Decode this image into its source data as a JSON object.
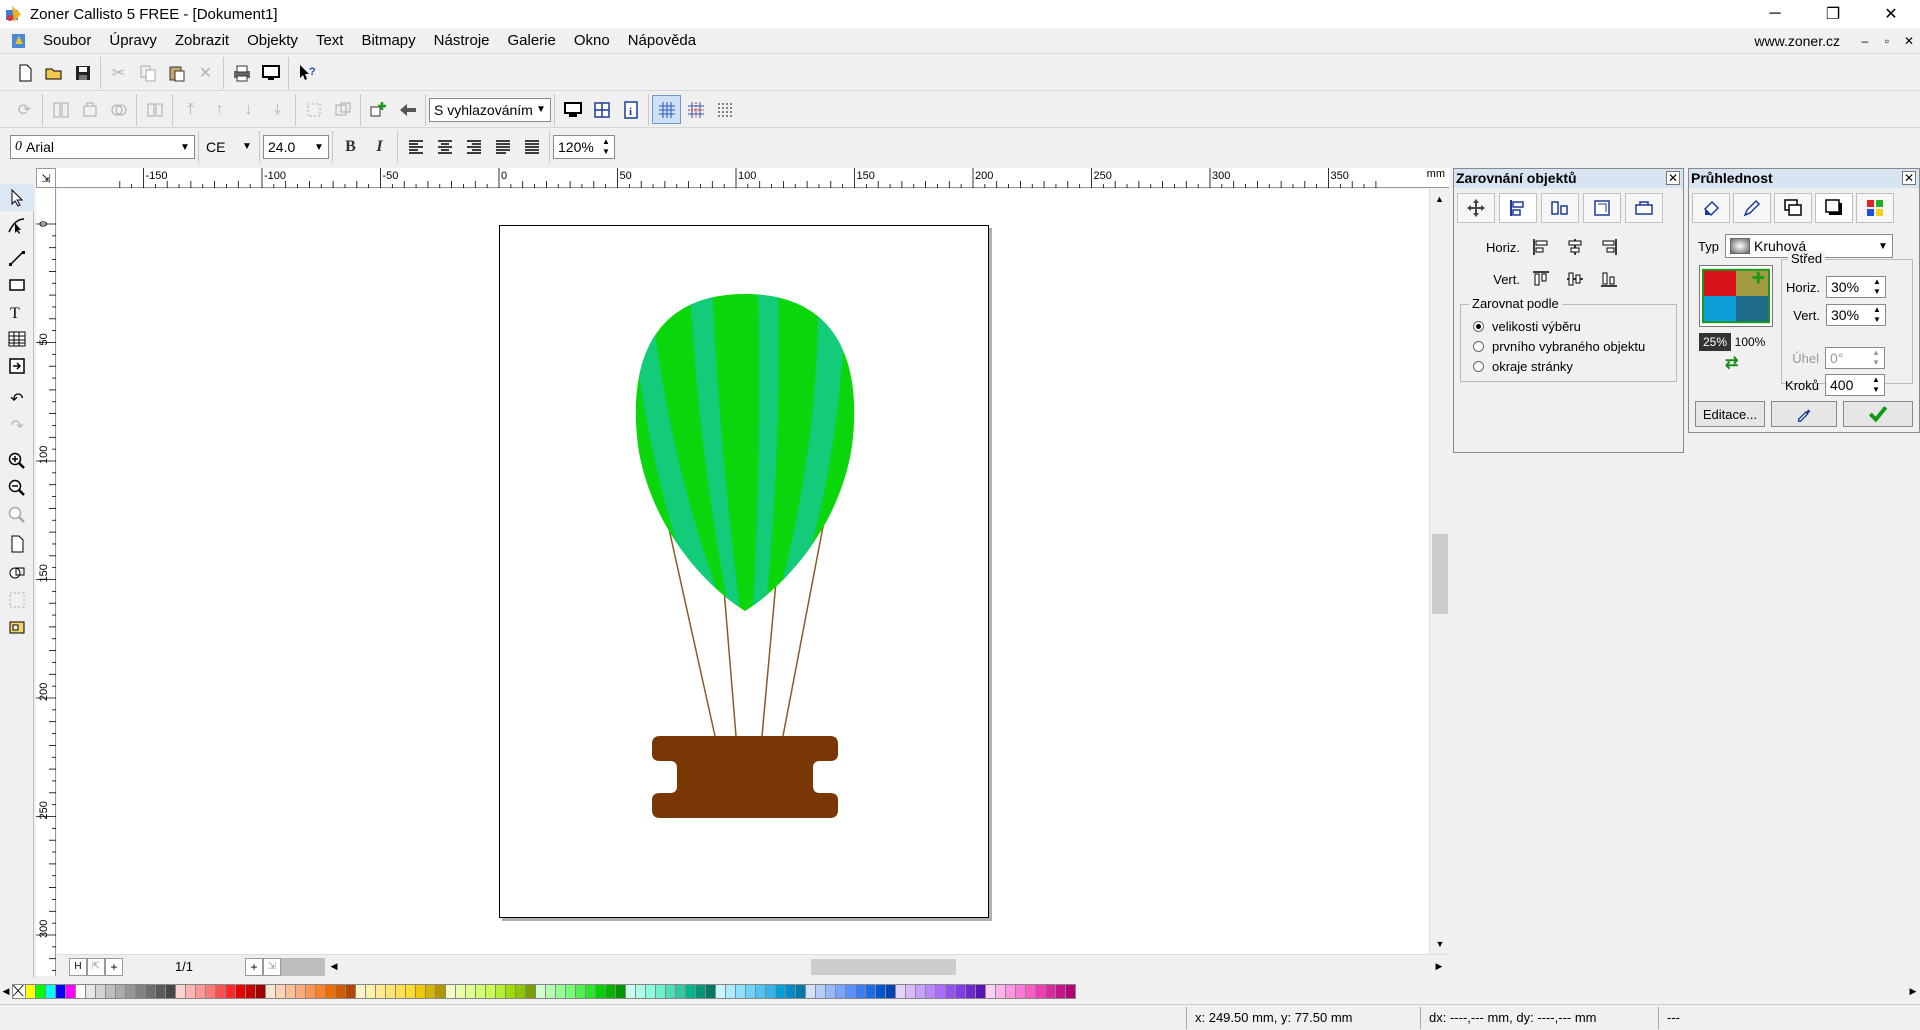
{
  "window": {
    "title": "Zoner Callisto 5 FREE - [Dokument1]",
    "controls": {
      "minimize": "─",
      "maximize": "❐",
      "close": "✕"
    }
  },
  "menu": {
    "items": [
      "Soubor",
      "Úpravy",
      "Zobrazit",
      "Objekty",
      "Text",
      "Bitmapy",
      "Nástroje",
      "Galerie",
      "Okno",
      "Nápověda"
    ],
    "site": "www.zoner.cz",
    "mdi": {
      "minimize": "–",
      "restore": "▫",
      "close": "✕"
    }
  },
  "toolbar2": {
    "smoothing": "S vyhlazováním"
  },
  "toolbar3": {
    "font": "Arial",
    "charset": "CE",
    "size": "24.0",
    "bold": "B",
    "italic": "I",
    "spacing": "120%"
  },
  "rulers": {
    "unit": "mm",
    "h_ticks": [
      "-150",
      "-100",
      "-50",
      "0",
      "50",
      "100",
      "150",
      "200",
      "250",
      "300",
      "350"
    ],
    "v_ticks": [
      "0",
      "50",
      "100",
      "150",
      "200",
      "250",
      "300"
    ]
  },
  "pager": {
    "first": "H",
    "prev": "⇱",
    "add": "+",
    "page": "1/1",
    "add2": "+",
    "last": "⇲"
  },
  "align_panel": {
    "title": "Zarovnání objektů",
    "horiz_label": "Horiz.",
    "vert_label": "Vert.",
    "group_label": "Zarovnat podle",
    "options": [
      "velikosti výběru",
      "prvního vybraného objektu",
      "okraje stránky"
    ],
    "selected": 0
  },
  "transparency_panel": {
    "title": "Průhlednost",
    "type_label": "Typ",
    "type_value": "Kruhová",
    "center_label": "Střed",
    "horiz_label": "Horiz.",
    "horiz_value": "30%",
    "vert_label": "Vert.",
    "vert_value": "30%",
    "angle_label": "Úhel",
    "angle_value": "0°",
    "steps_label": "Kroků",
    "steps_value": "400",
    "start_pct": "25%",
    "end_pct": "100%",
    "edit_button": "Editace..."
  },
  "status": {
    "coords": "x: 249.50 mm, y: 77.50 mm",
    "delta": "dx: ----,--- mm, dy: ----,--- mm",
    "extra": "---"
  },
  "palette_colors": [
    "#ffff00",
    "#00ff00",
    "#00ffff",
    "#0000ff",
    "#ff00ff",
    "#ffffff",
    "#e6e6e6",
    "#d2d2d2",
    "#bebebe",
    "#aaaaaa",
    "#969696",
    "#828282",
    "#6e6e6e",
    "#5a5a5a",
    "#464646",
    "#ffd2d2",
    "#ffb4b4",
    "#ff9696",
    "#ff7878",
    "#ff5050",
    "#ff2828",
    "#e60000",
    "#c80000",
    "#a00000",
    "#ffe6d2",
    "#ffd2b4",
    "#ffbe96",
    "#ffaa78",
    "#ff9650",
    "#ff8228",
    "#f06e00",
    "#d25a00",
    "#b44600",
    "#fff5c8",
    "#fff0aa",
    "#ffeb8c",
    "#ffe66e",
    "#ffe150",
    "#ffdc32",
    "#f0c800",
    "#d2b400",
    "#b49600",
    "#f5ffc8",
    "#ebffaa",
    "#e1ff8c",
    "#d2ff6e",
    "#c8ff50",
    "#b4f032",
    "#a0dc00",
    "#8cc800",
    "#78a000",
    "#d2ffd2",
    "#b4ffb4",
    "#96ff96",
    "#78ff78",
    "#50f050",
    "#28e628",
    "#00d200",
    "#00b400",
    "#009600",
    "#c8fff0",
    "#aaffe6",
    "#8cffdc",
    "#6ef0c8",
    "#50dcb4",
    "#32c8a0",
    "#00b48c",
    "#009678",
    "#007864",
    "#c8f5ff",
    "#aaebff",
    "#8ce1ff",
    "#6ed2ff",
    "#50c3f5",
    "#32b4eb",
    "#00a0dc",
    "#008cc8",
    "#0078aa",
    "#d2e1ff",
    "#b4cdff",
    "#96b9ff",
    "#78a5ff",
    "#5a91ff",
    "#3c7df5",
    "#1e69e6",
    "#0055d2",
    "#0041b4",
    "#e6d2ff",
    "#d7b9ff",
    "#c8a0ff",
    "#b987ff",
    "#aa6eff",
    "#9650f0",
    "#823ce6",
    "#6e28d2",
    "#5a14b4",
    "#ffd2f5",
    "#ffb4eb",
    "#ff96e1",
    "#ff78d7",
    "#ff5ac8",
    "#f03cb4",
    "#dc28a0",
    "#c8148c",
    "#b40078"
  ],
  "balloon_colors": {
    "light": "#0bd50b",
    "stripe": "#12cc7a",
    "basket": "#7a3706",
    "rope": "#8a5a2b"
  }
}
